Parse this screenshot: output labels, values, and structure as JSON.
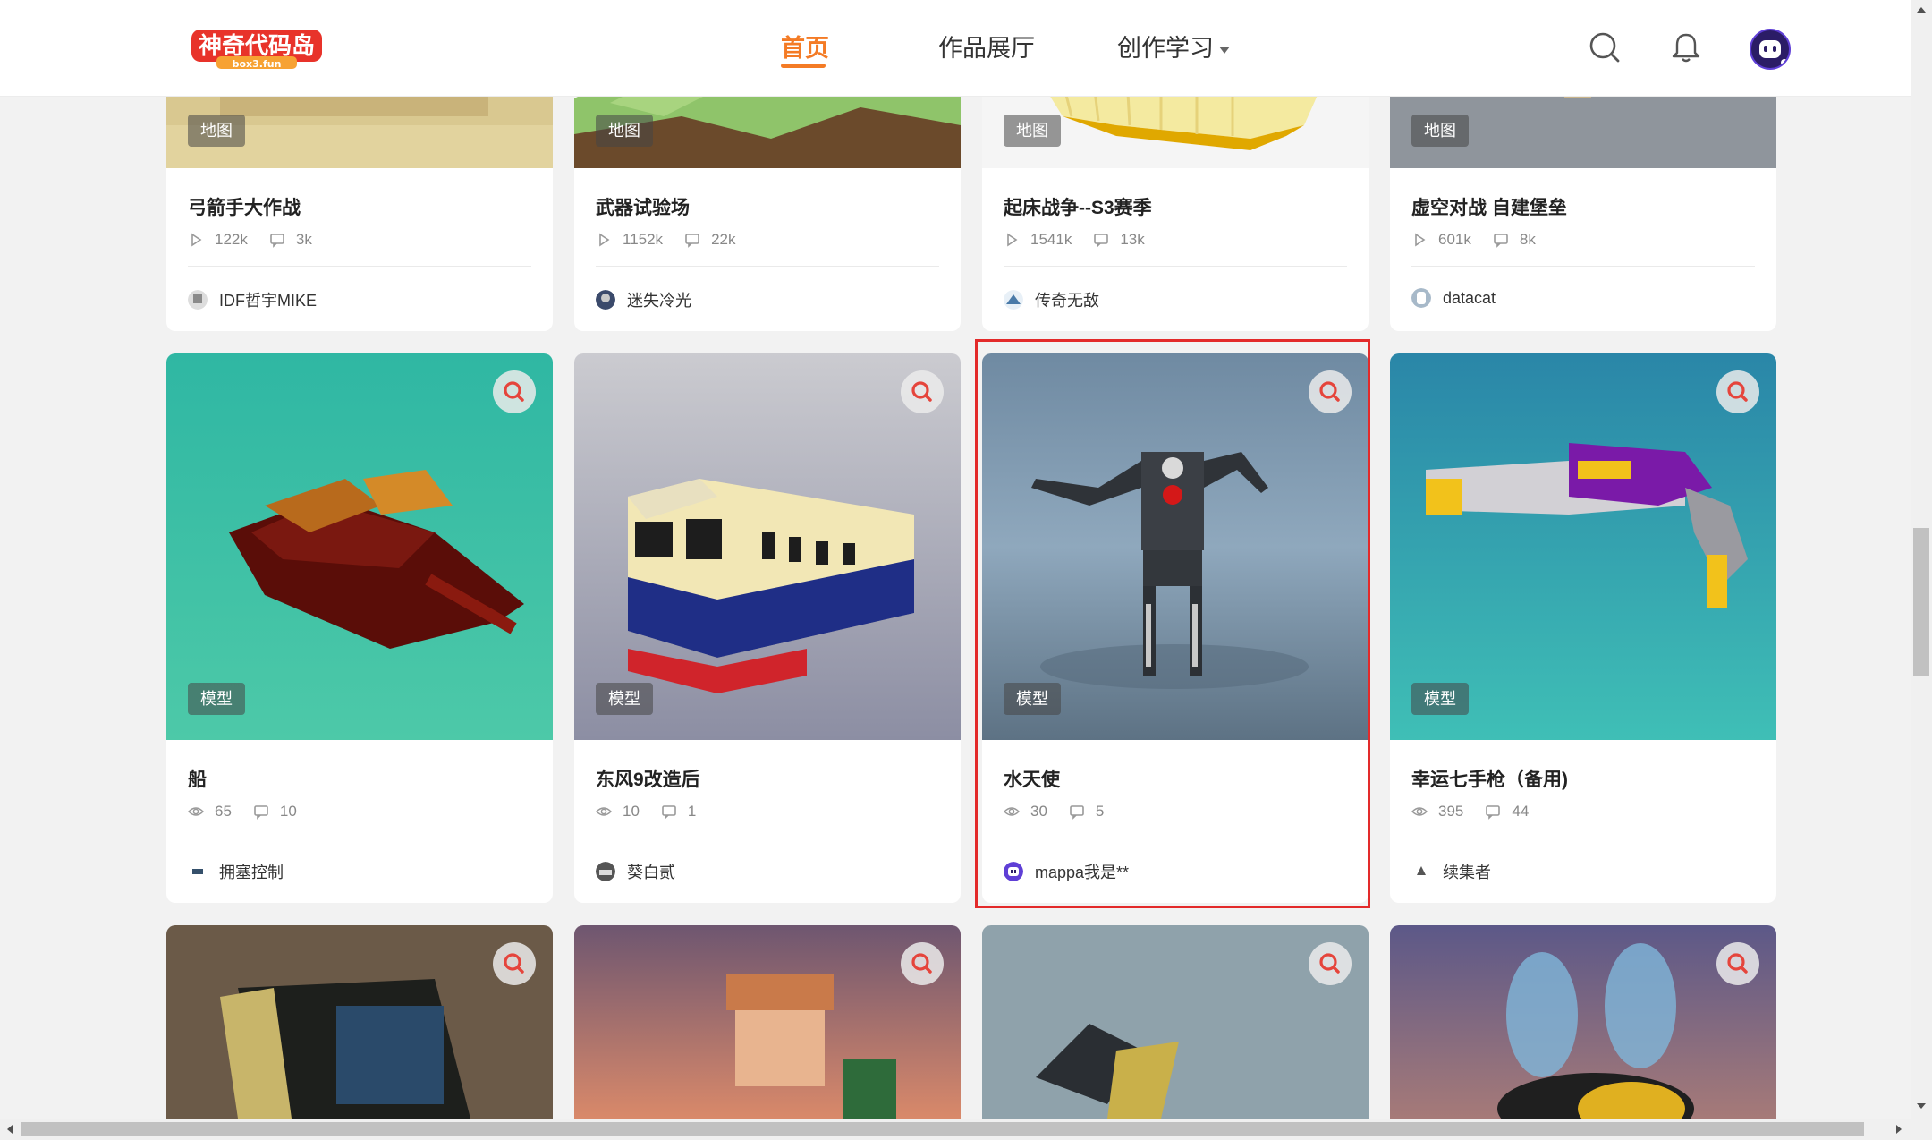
{
  "header": {
    "logo_alt": "神奇代码岛",
    "logo_sub": "box3.fun",
    "nav": [
      {
        "label": "首页",
        "active": true
      },
      {
        "label": "作品展厅",
        "active": false
      },
      {
        "label": "创作学习",
        "active": false,
        "has_dropdown": true
      }
    ],
    "icons": [
      "search-icon",
      "bell-icon",
      "user-avatar"
    ]
  },
  "rows": [
    {
      "cards": [
        {
          "tag": "地图",
          "title": "弓箭手大作战",
          "views": "122k",
          "comments": "3k",
          "stat_icon": "play-icon",
          "author": "IDF哲宇MIKE"
        },
        {
          "tag": "地图",
          "title": "武器试验场",
          "views": "1152k",
          "comments": "22k",
          "stat_icon": "play-icon",
          "author": "迷失冷光"
        },
        {
          "tag": "地图",
          "title": "起床战争--S3赛季",
          "views": "1541k",
          "comments": "13k",
          "stat_icon": "play-icon",
          "author": "传奇无敌"
        },
        {
          "tag": "地图",
          "title": "虚空对战 自建堡垒",
          "views": "601k",
          "comments": "8k",
          "stat_icon": "play-icon",
          "author": "datacat"
        }
      ]
    },
    {
      "cards": [
        {
          "tag": "模型",
          "title": "船",
          "views": "65",
          "comments": "10",
          "stat_icon": "eye-icon",
          "author": "拥塞控制"
        },
        {
          "tag": "模型",
          "title": "东风9改造后",
          "views": "10",
          "comments": "1",
          "stat_icon": "eye-icon",
          "author": "葵白贰"
        },
        {
          "tag": "模型",
          "title": "水天使",
          "views": "30",
          "comments": "5",
          "stat_icon": "eye-icon",
          "author": "mappa我是**",
          "highlighted": true
        },
        {
          "tag": "模型",
          "title": "幸运七手枪（备用)",
          "views": "395",
          "comments": "44",
          "stat_icon": "eye-icon",
          "author": "续集者"
        }
      ]
    }
  ],
  "colors": {
    "accent": "#f47b25",
    "highlight_border": "#e32a2a",
    "page_bg": "#f2f2f2"
  }
}
